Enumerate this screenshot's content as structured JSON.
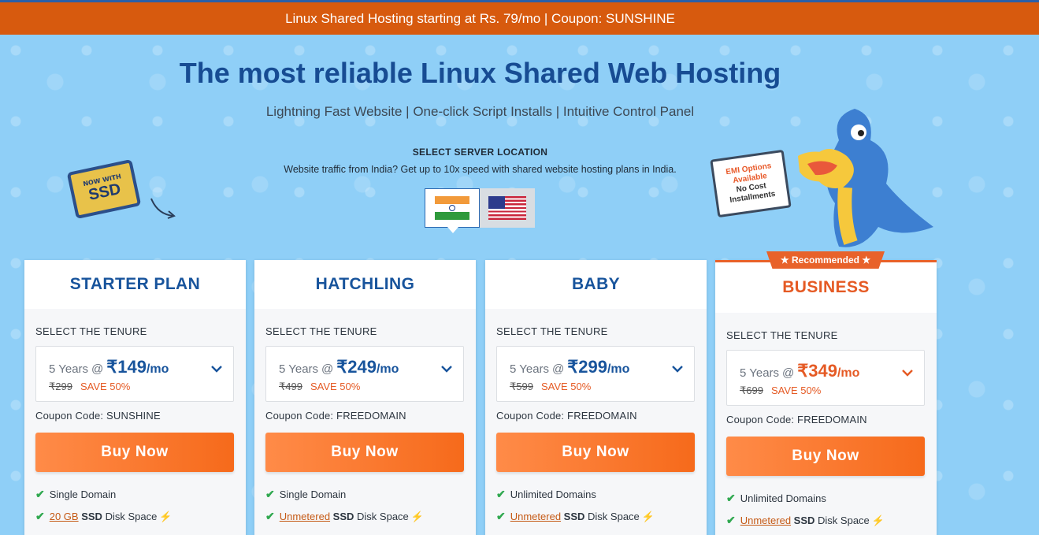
{
  "promo_bar": {
    "text": "Linux Shared Hosting starting at Rs. 79/mo | Coupon: SUNSHINE"
  },
  "hero": {
    "headline": "The most reliable Linux Shared Web Hosting",
    "subline": "Lightning Fast Website | One-click Script Installs | Intuitive Control Panel"
  },
  "location": {
    "title": "SELECT SERVER LOCATION",
    "description": "Website traffic from India? Get up to 10x speed with shared website hosting plans in India.",
    "options": [
      {
        "name": "India",
        "selected": true
      },
      {
        "name": "United States",
        "selected": false
      }
    ]
  },
  "badges": {
    "ssd_small": "NOW WITH",
    "ssd_big": "SSD",
    "emi_line1": "EMI Options",
    "emi_line2": "Available",
    "emi_line3": "No Cost",
    "emi_line4": "Installments"
  },
  "plans": [
    {
      "name": "STARTER PLAN",
      "tenure_label": "SELECT THE TENURE",
      "years": "5 Years",
      "at": "@",
      "price": "₹149",
      "per": "/mo",
      "old_price": "₹299",
      "save": "SAVE 50%",
      "coupon": "Coupon Code: SUNSHINE",
      "buy_label": "Buy Now",
      "feature1": "Single Domain",
      "feature2_u": "20 GB",
      "feature2_b": "SSD",
      "feature2_t": "Disk Space"
    },
    {
      "name": "HATCHLING",
      "tenure_label": "SELECT THE TENURE",
      "years": "5 Years",
      "at": "@",
      "price": "₹249",
      "per": "/mo",
      "old_price": "₹499",
      "save": "SAVE 50%",
      "coupon": "Coupon Code: FREEDOMAIN",
      "buy_label": "Buy Now",
      "feature1": "Single Domain",
      "feature2_u": "Unmetered",
      "feature2_b": "SSD",
      "feature2_t": "Disk Space"
    },
    {
      "name": "BABY",
      "tenure_label": "SELECT THE TENURE",
      "years": "5 Years",
      "at": "@",
      "price": "₹299",
      "per": "/mo",
      "old_price": "₹599",
      "save": "SAVE 50%",
      "coupon": "Coupon Code: FREEDOMAIN",
      "buy_label": "Buy Now",
      "feature1": "Unlimited Domains",
      "feature2_u": "Unmetered",
      "feature2_b": "SSD",
      "feature2_t": "Disk Space"
    },
    {
      "name": "BUSINESS",
      "ribbon": "★ Recommended ★",
      "tenure_label": "SELECT THE TENURE",
      "years": "5 Years",
      "at": "@",
      "price": "₹349",
      "per": "/mo",
      "old_price": "₹699",
      "save": "SAVE 50%",
      "coupon": "Coupon Code: FREEDOMAIN",
      "buy_label": "Buy Now",
      "feature1": "Unlimited Domains",
      "feature2_u": "Unmetered",
      "feature2_b": "SSD",
      "feature2_t": "Disk Space"
    }
  ],
  "icons": {
    "check": "check-icon",
    "bolt": "lightning-icon",
    "chevron": "chevron-down-icon"
  },
  "colors": {
    "brand_blue": "#18549c",
    "accent_orange": "#e55a24",
    "promo_bg": "#d75a0e",
    "check_green": "#2fa84f"
  }
}
